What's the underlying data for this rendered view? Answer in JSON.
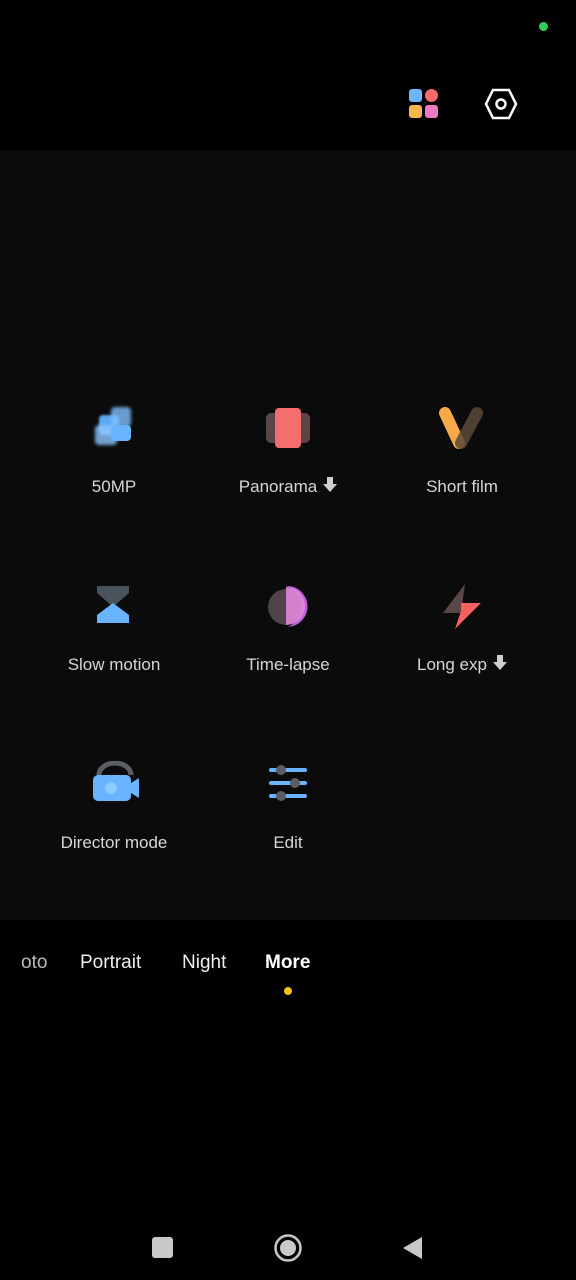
{
  "status": {
    "privacy_indicator_color": "#2fd05a"
  },
  "toolbar": {
    "apps_icon": "grid-apps-icon",
    "settings_icon": "settings-hexagon-icon"
  },
  "modes": [
    {
      "label": "50MP",
      "icon": "50mp-icon",
      "download": false
    },
    {
      "label": "Panorama",
      "icon": "panorama-icon",
      "download": true
    },
    {
      "label": "Short film",
      "icon": "short-film-icon",
      "download": false
    },
    {
      "label": "Slow motion",
      "icon": "slow-motion-icon",
      "download": false
    },
    {
      "label": "Time-lapse",
      "icon": "time-lapse-icon",
      "download": false
    },
    {
      "label": "Long exp",
      "icon": "long-exposure-icon",
      "download": true
    },
    {
      "label": "Director mode",
      "icon": "director-mode-icon",
      "download": false
    },
    {
      "label": "Edit",
      "icon": "edit-sliders-icon",
      "download": false
    }
  ],
  "mode_tabs": [
    "oto",
    "Portrait",
    "Night",
    "More"
  ],
  "active_tab": "More",
  "accent": "#f3c018"
}
